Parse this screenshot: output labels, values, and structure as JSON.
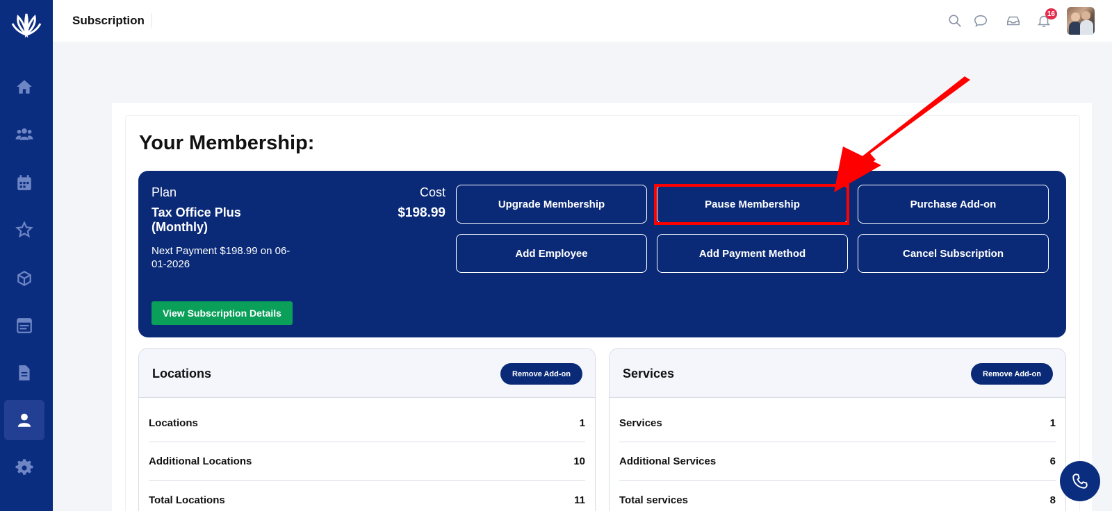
{
  "app": {
    "page_title": "Subscription",
    "notification_count": "16"
  },
  "sidebar": {
    "items": [
      {
        "icon": "home-icon"
      },
      {
        "icon": "users-icon"
      },
      {
        "icon": "calendar-icon"
      },
      {
        "icon": "star-icon"
      },
      {
        "icon": "box-icon"
      },
      {
        "icon": "browser-icon"
      },
      {
        "icon": "document-icon"
      },
      {
        "icon": "user-icon",
        "active": true
      },
      {
        "icon": "gear-icon"
      }
    ]
  },
  "membership": {
    "heading": "Your Membership:",
    "plan_label": "Plan",
    "plan_name": "Tax Office Plus (Monthly)",
    "next_payment": "Next Payment $198.99 on 06-01-2026",
    "cost_label": "Cost",
    "cost": "$198.99",
    "buttons": {
      "upgrade": "Upgrade Membership",
      "pause": "Pause Membership",
      "purchase_addon": "Purchase Add-on",
      "add_employee": "Add Employee",
      "add_payment": "Add Payment Method",
      "cancel": "Cancel Subscription"
    },
    "view_details": "View Subscription Details"
  },
  "locations_card": {
    "title": "Locations",
    "remove_label": "Remove Add-on",
    "rows": [
      {
        "label": "Locations",
        "value": "1"
      },
      {
        "label": "Additional Locations",
        "value": "10"
      },
      {
        "label": "Total Locations",
        "value": "11"
      }
    ]
  },
  "services_card": {
    "title": "Services",
    "remove_label": "Remove Add-on",
    "rows": [
      {
        "label": "Services",
        "value": "1"
      },
      {
        "label": "Additional Services",
        "value": "6"
      },
      {
        "label": "Total services",
        "value": "8"
      }
    ]
  },
  "colors": {
    "sidebar": "#0b2d80",
    "membership_bg": "#0a2a78",
    "view_button": "#0aa05a",
    "highlight": "#ff0000",
    "badge": "#e32b4b"
  }
}
